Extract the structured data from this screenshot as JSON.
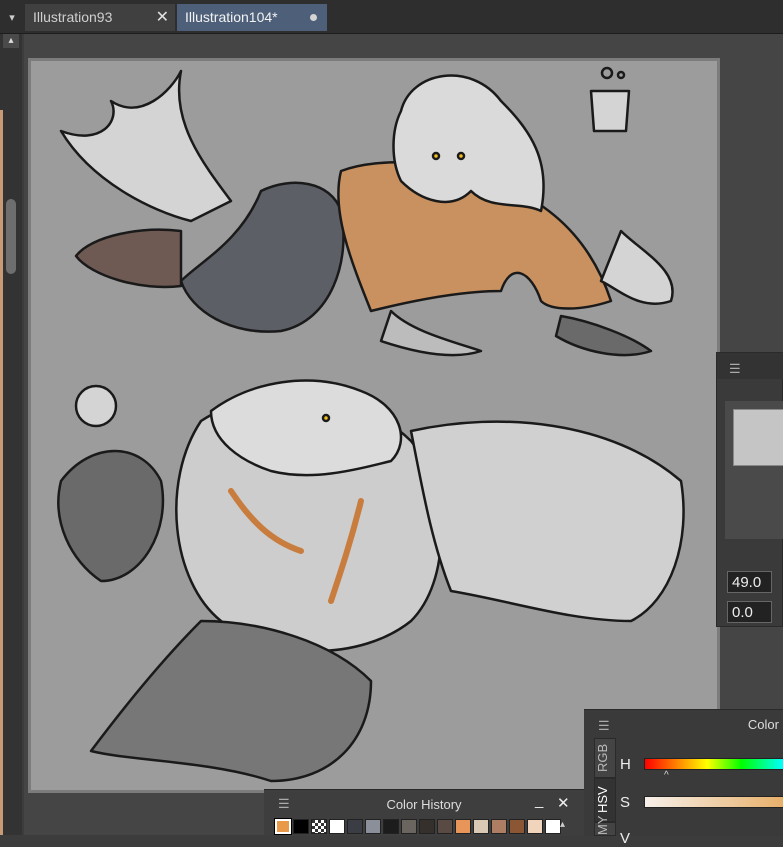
{
  "tabs": [
    {
      "label": "Illustration93"
    },
    {
      "label": "Illustration104*"
    }
  ],
  "navigator": {
    "zoom": "49.0",
    "angle": "0.0"
  },
  "color_history": {
    "title": "Color History",
    "swatches": [
      "#e89a4a",
      "#000000",
      "checker",
      "#ffffff",
      "#3a3d44",
      "#8a8f99",
      "#1c1c1c",
      "#6b6560",
      "#35302c",
      "#5a4a44",
      "#e8955a",
      "#d8c8b4",
      "#ad7e63",
      "#8a5634",
      "#f1d4bc",
      "#ffffff"
    ]
  },
  "color_panel": {
    "title": "Color",
    "tabs": [
      "RGB",
      "HSV",
      "MY"
    ],
    "labels": {
      "h": "H",
      "s": "S",
      "v": "V"
    }
  },
  "colors": {
    "accent_tab": "#4e6079",
    "jacket": "#c8915f",
    "canvas": "#9c9c9c"
  }
}
